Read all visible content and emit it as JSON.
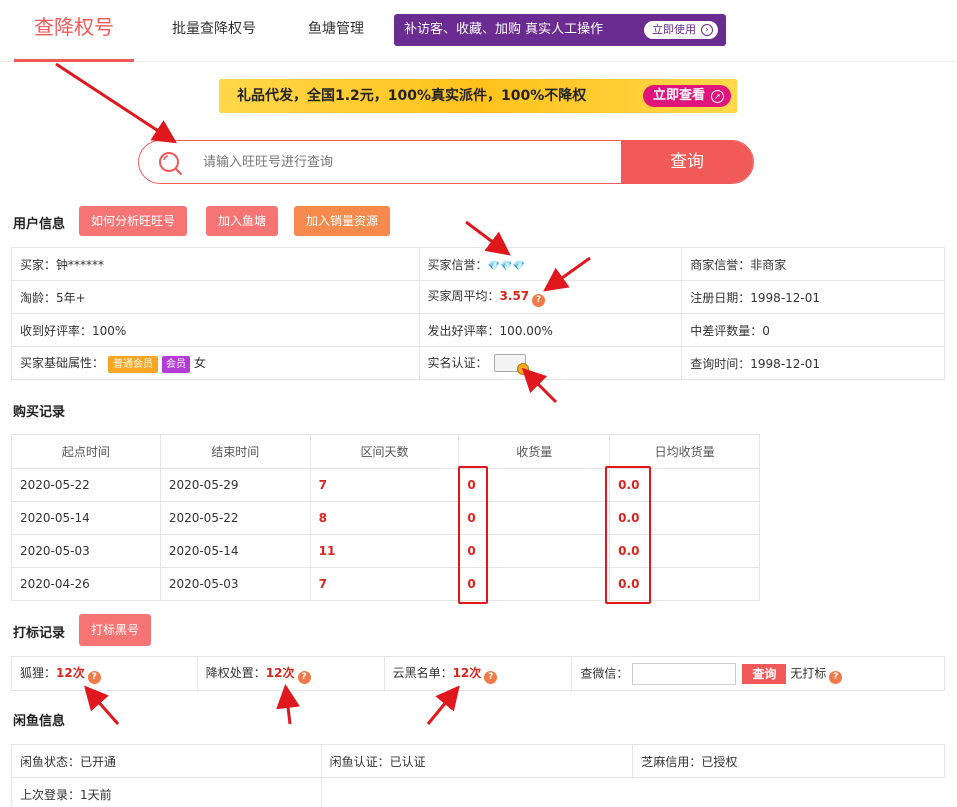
{
  "nav": {
    "active_tab": "查降权号",
    "tab_batch": "批量查降权号",
    "tab_pond": "鱼塘管理",
    "promo_text": "补访客、收藏、加购 真实人工操作",
    "promo_btn": "立即使用"
  },
  "banner": {
    "text": "礼品代发，全国1.2元，100%真实派件，100%不降权",
    "btn": "立即查看"
  },
  "search": {
    "placeholder": "请输入旺旺号进行查询",
    "btn": "查询"
  },
  "user_info": {
    "title": "用户信息",
    "btn_analyze": "如何分析旺旺号",
    "btn_pond": "加入鱼塘",
    "btn_resource": "加入销量资源",
    "buyer_label": "买家：",
    "buyer_value": "钟******",
    "buyer_credit_label": "买家信誉：",
    "buyer_credit_icons": "💎💎💎",
    "merchant_credit_label": "商家信誉：",
    "merchant_credit_value": "非商家",
    "tao_age_label": "淘龄：",
    "tao_age_value": "5年+",
    "weekly_avg_label": "买家周平均：",
    "weekly_avg_value": "3.57",
    "reg_date_label": "注册日期：",
    "reg_date_value": "1998-12-01",
    "good_rate_recv_label": "收到好评率：",
    "good_rate_recv_value": "100%",
    "good_rate_sent_label": "发出好评率：",
    "good_rate_sent_value": "100.00%",
    "mid_bad_label": "中差评数量：",
    "mid_bad_value": "0",
    "base_attr_label": "买家基础属性：",
    "vip_badge": "普通会员",
    "vip2_badge": "会员",
    "gender": "女",
    "realname_label": "实名认证：",
    "query_time_label": "查询时间：",
    "query_time_value": "1998-12-01"
  },
  "purchase": {
    "title": "购买记录",
    "headers": [
      "起点时间",
      "结束时间",
      "区间天数",
      "收货量",
      "日均收货量"
    ],
    "rows": [
      [
        "2020-05-22",
        "2020-05-29",
        "7",
        "0",
        "0.0"
      ],
      [
        "2020-05-14",
        "2020-05-22",
        "8",
        "0",
        "0.0"
      ],
      [
        "2020-05-03",
        "2020-05-14",
        "11",
        "0",
        "0.0"
      ],
      [
        "2020-04-26",
        "2020-05-03",
        "7",
        "0",
        "0.0"
      ]
    ]
  },
  "mark": {
    "title": "打标记录",
    "btn": "打标黑号",
    "fox_label": "狐狸：",
    "fox_value": "12次",
    "downgrade_label": "降权处置：",
    "downgrade_value": "12次",
    "cloud_label": "云黑名单：",
    "cloud_value": "12次",
    "wechat_label": "查微信：",
    "wechat_btn": "查询",
    "no_mark": "无打标"
  },
  "xianyu": {
    "title": "闲鱼信息",
    "status_label": "闲鱼状态：",
    "status_value": "已开通",
    "cert_label": "闲鱼认证：",
    "cert_value": "已认证",
    "sesame_label": "芝麻信用：",
    "sesame_value": "已授权",
    "last_login_label": "上次登录：",
    "last_login_value": "1天前"
  },
  "colors": {
    "accent": "#f25a5a",
    "promo_purple": "#6a2c91",
    "annotation_red": "#e0181e"
  }
}
